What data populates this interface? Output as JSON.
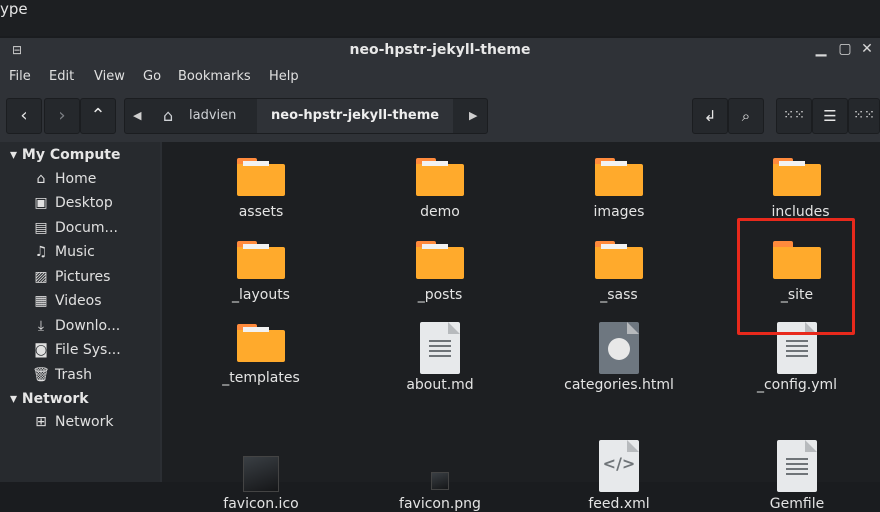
{
  "top_strip_text": "ype",
  "window": {
    "title": "neo-hpstr-jekyll-theme"
  },
  "menu": [
    "File",
    "Edit",
    "View",
    "Go",
    "Bookmarks",
    "Help"
  ],
  "breadcrumb": {
    "items": [
      "ladvien",
      "neo-hpstr-jekyll-theme"
    ]
  },
  "sidebar": {
    "section1": "My Compute",
    "items1": [
      {
        "label": "Home",
        "icon": "home-icon"
      },
      {
        "label": "Desktop",
        "icon": "desktop-icon"
      },
      {
        "label": "Docum...",
        "icon": "documents-icon"
      },
      {
        "label": "Music",
        "icon": "music-icon"
      },
      {
        "label": "Pictures",
        "icon": "pictures-icon"
      },
      {
        "label": "Videos",
        "icon": "videos-icon"
      },
      {
        "label": "Downlo...",
        "icon": "downloads-icon"
      },
      {
        "label": "File Sys...",
        "icon": "filesystem-icon"
      },
      {
        "label": "Trash",
        "icon": "trash-icon"
      }
    ],
    "section2": "Network",
    "items2": [
      {
        "label": "Network",
        "icon": "network-icon"
      }
    ]
  },
  "files": [
    {
      "name": "assets",
      "type": "folder"
    },
    {
      "name": "demo",
      "type": "folder"
    },
    {
      "name": "images",
      "type": "folder"
    },
    {
      "name": "_includes",
      "type": "folder"
    },
    {
      "name": "_layouts",
      "type": "folder"
    },
    {
      "name": "_posts",
      "type": "folder"
    },
    {
      "name": "_sass",
      "type": "folder"
    },
    {
      "name": "_site",
      "type": "folder"
    },
    {
      "name": "_templates",
      "type": "folder"
    },
    {
      "name": "about.md",
      "type": "document"
    },
    {
      "name": "categories.html",
      "type": "html"
    },
    {
      "name": "_config.yml",
      "type": "document"
    },
    {
      "name": "favicon.ico",
      "type": "image"
    },
    {
      "name": "favicon.png",
      "type": "image-small"
    },
    {
      "name": "feed.xml",
      "type": "xml"
    },
    {
      "name": "Gemfile",
      "type": "document"
    }
  ],
  "highlight_color": "#e8291c"
}
